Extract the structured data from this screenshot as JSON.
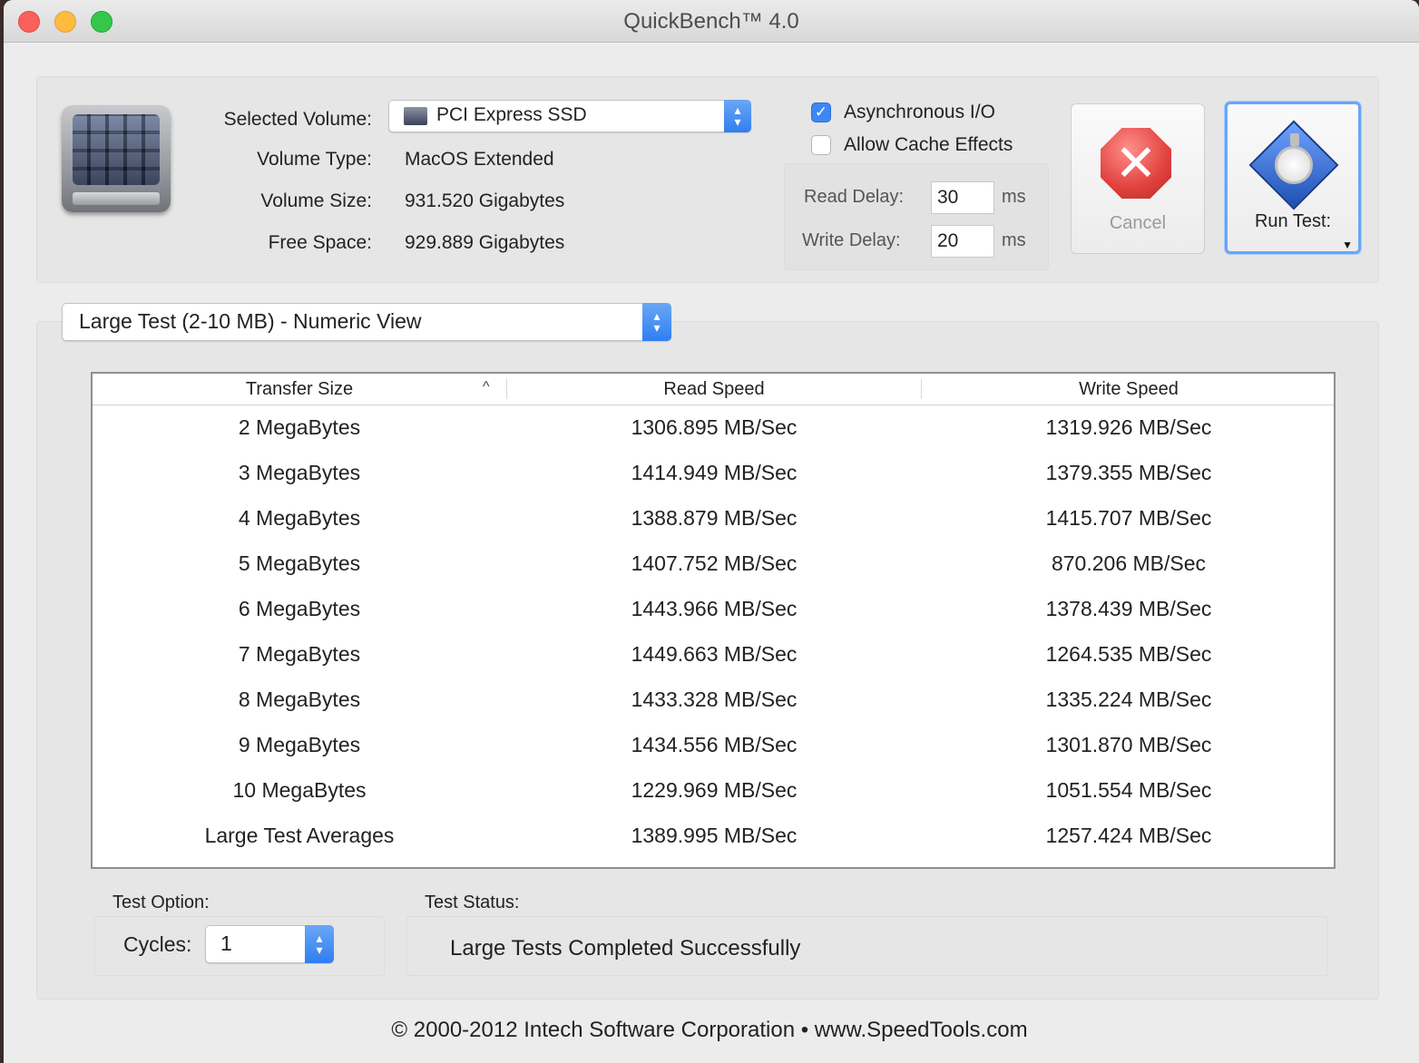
{
  "window": {
    "title": "QuickBench™ 4.0"
  },
  "volume": {
    "selected_label": "Selected Volume:",
    "selected_value": "PCI Express SSD",
    "type_label": "Volume Type:",
    "type_value": "MacOS Extended",
    "size_label": "Volume Size:",
    "size_value": "931.520 Gigabytes",
    "free_label": "Free Space:",
    "free_value": "929.889 Gigabytes"
  },
  "options": {
    "async_label": "Asynchronous I/O",
    "async_checked": true,
    "cache_label": "Allow Cache Effects",
    "cache_checked": false,
    "read_delay_label": "Read Delay:",
    "read_delay_value": "30",
    "write_delay_label": "Write Delay:",
    "write_delay_value": "20",
    "ms_unit": "ms"
  },
  "buttons": {
    "cancel_label": "Cancel",
    "run_label": "Run Test:"
  },
  "view_select": {
    "value": "Large Test (2-10 MB) - Numeric View"
  },
  "table": {
    "headers": [
      "Transfer Size",
      "Read Speed",
      "Write Speed"
    ],
    "rows": [
      [
        "2 MegaBytes",
        "1306.895 MB/Sec",
        "1319.926 MB/Sec"
      ],
      [
        "3 MegaBytes",
        "1414.949 MB/Sec",
        "1379.355 MB/Sec"
      ],
      [
        "4 MegaBytes",
        "1388.879 MB/Sec",
        "1415.707 MB/Sec"
      ],
      [
        "5 MegaBytes",
        "1407.752 MB/Sec",
        "870.206 MB/Sec"
      ],
      [
        "6 MegaBytes",
        "1443.966 MB/Sec",
        "1378.439 MB/Sec"
      ],
      [
        "7 MegaBytes",
        "1449.663 MB/Sec",
        "1264.535 MB/Sec"
      ],
      [
        "8 MegaBytes",
        "1433.328 MB/Sec",
        "1335.224 MB/Sec"
      ],
      [
        "9 MegaBytes",
        "1434.556 MB/Sec",
        "1301.870 MB/Sec"
      ],
      [
        "10 MegaBytes",
        "1229.969 MB/Sec",
        "1051.554 MB/Sec"
      ],
      [
        "Large Test Averages",
        "1389.995 MB/Sec",
        "1257.424 MB/Sec"
      ]
    ]
  },
  "test_option": {
    "label": "Test Option:",
    "cycles_label": "Cycles:",
    "cycles_value": "1"
  },
  "test_status": {
    "label": "Test Status:",
    "text": "Large Tests Completed Successfully"
  },
  "footer": "© 2000-2012 Intech Software Corporation • www.SpeedTools.com",
  "colors": {
    "accent": "#3b87f5",
    "stop_red": "#e1413d",
    "background": "#ececec"
  },
  "icons": [
    "close-icon",
    "minimize-icon",
    "zoom-icon",
    "drive-icon",
    "volume-icon",
    "stepper-icon",
    "check-icon",
    "stop-icon",
    "stopwatch-icon",
    "dropdown-arrow-icon",
    "sort-ascending-icon"
  ]
}
